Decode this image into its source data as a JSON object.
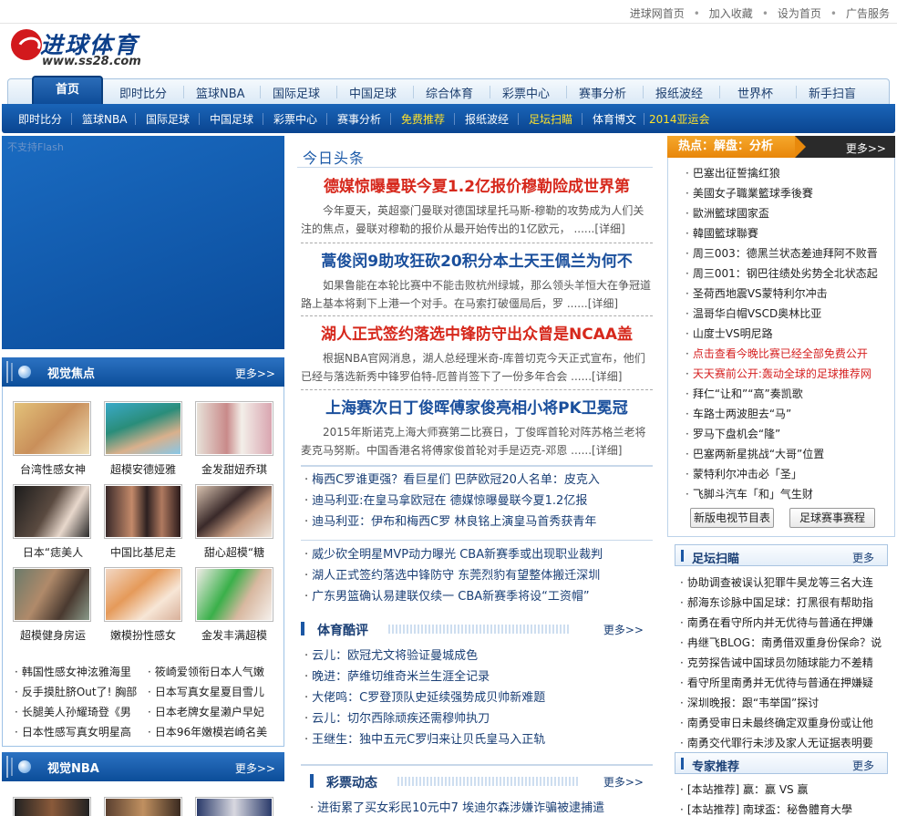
{
  "toplinks": [
    "进球网首页",
    "加入收藏",
    "设为首页",
    "广告服务"
  ],
  "logo": {
    "name": "进球体育",
    "url": "www.ss28.com"
  },
  "nav1": {
    "home": "首页",
    "items": [
      "即时比分",
      "篮球NBA",
      "国际足球",
      "中国足球",
      "综合体育",
      "彩票中心",
      "赛事分析",
      "报纸波经",
      "世界杯",
      "新手扫盲"
    ]
  },
  "nav2": {
    "items": [
      "即时比分",
      "篮球NBA",
      "国际足球",
      "中国足球",
      "彩票中心",
      "赛事分析",
      "免费推荐",
      "报纸波经",
      "足坛扫瞄",
      "体育博文",
      "2014亚运会"
    ],
    "highlight": [
      "免费推荐",
      "足坛扫瞄",
      "2014亚运会"
    ]
  },
  "flash": {
    "text": "不支持Flash"
  },
  "visual_focus": {
    "title": "视觉焦点",
    "more": "更多>>",
    "thumbs": [
      "台湾性感女神",
      "超模安德娅雅",
      "金发甜妞乔琪",
      "日本“痣美人",
      "中国比基尼走",
      "甜心超模“糖",
      "超模健身房运",
      "嫩模扮性感女",
      "金发丰满超模"
    ],
    "list_left": [
      "韩国性感女神泫雅海里",
      "反手摸肚脐Out了! 胸部",
      "长腿美人孙耀琦登《男",
      "日本性感写真女明星高"
    ],
    "list_right": [
      "筱崎爱领衔日本人气嫩",
      "日本写真女星夏目雪儿",
      "日本老牌女星濑户早妃",
      "日本96年嫩模岩崎名美"
    ]
  },
  "visual_nba": {
    "title": "视觉NBA",
    "more": "更多>>"
  },
  "headlines": {
    "title": "今日头条",
    "items": [
      {
        "h": "德媒惊曝曼联今夏1.2亿报价穆勒险成世界第",
        "p": "今年夏天，英超豪门曼联对德国球星托马斯-穆勒的攻势成为人们关注的焦点，曼联对穆勒的报价从最开始传出的1亿欧元， ......[详细]",
        "color": "red"
      },
      {
        "h": "蒿俊闵9助攻狂砍20积分本土天王佩兰为何不",
        "p": "如果鲁能在本轮比赛中不能击败杭州绿城，那么领头羊恒大在争冠道路上基本将剩下上港一个对手。在马索打破僵局后，罗 ......[详细]",
        "color": "blue"
      },
      {
        "h": "湖人正式签约落选中锋防守出众曾是NCAA盖",
        "p": "根据NBA官网消息，湖人总经理米奇-库普切克今天正式宣布，他们已经与落选新秀中锋罗伯特-厄普肖签下了一份多年合会 ......[详细]",
        "color": "red"
      },
      {
        "h": "上海赛次日丁俊晖傅家俊亮相小将PK卫冕冠",
        "p": "2015年斯诺克上海大师赛第二比赛日，丁俊晖首轮对阵苏格兰老将麦克马努斯。中国香港名将傅家俊首轮对手是迈克-邓恩 ......[详细]",
        "color": "blue"
      }
    ]
  },
  "center_list1": [
    "梅西C罗谁更强？看巨星们 巴萨欧冠20人名单：皮克入",
    "迪马利亚:在皇马拿欧冠在 德媒惊曝曼联今夏1.2亿报",
    "迪马利亚：伊布和梅西C罗 林良铭上演皇马首秀获青年"
  ],
  "center_list2": [
    "威少砍全明星MVP动力曝光 CBA新赛季或出现职业裁判",
    "湖人正式签约落选中锋防守 东莞烈豹有望整体搬迁深圳",
    "广东男篮确认易建联仅续一 CBA新赛季将设“工资帽”"
  ],
  "sports_comment": {
    "title": "体育酷评",
    "more": "更多>>",
    "items": [
      "云儿：欧冠尤文将验证曼城成色",
      "晚进：萨维切维奇米兰生涯全记录",
      "大佬鸣：C罗登顶队史延续强势成贝帅新难题",
      "云儿：切尔西除顽疾还需穆帅执刀",
      "王继生：独中五元C罗归来让贝氏皇马入正轨"
    ]
  },
  "lottery": {
    "title": "彩票动态",
    "more": "更多>>",
    "items": [
      "进街累了买女彩民10元中7 埃迪尔森涉嫌诈骗被逮捕遣"
    ]
  },
  "hot": {
    "title": "热点：解盘：分析",
    "more": "更多>>",
    "items": [
      {
        "t": "巴塞出征誓擒红狼",
        "red": false
      },
      {
        "t": "美國女子職業籃球季後賽",
        "red": false
      },
      {
        "t": "歐洲籃球國家盃",
        "red": false
      },
      {
        "t": "韓國籃球聯賽",
        "red": false
      },
      {
        "t": "周三003：德黑兰状态差迪拜阿不败晋",
        "red": false
      },
      {
        "t": "周三001：钢巴往绩处劣势全北状态起",
        "red": false
      },
      {
        "t": "圣荷西地震VS蒙特利尔冲击",
        "red": false
      },
      {
        "t": "温哥华白帽VSCD奥林比亚",
        "red": false
      },
      {
        "t": "山度士VS明尼路",
        "red": false
      },
      {
        "t": "点击查看今晚比赛已经全部免费公开",
        "red": true
      },
      {
        "t": "天天赛前公开:轰动全球的足球推荐网",
        "red": true
      },
      {
        "t": "拜仁“让和”“高”奏凯歌",
        "red": false
      },
      {
        "t": "车路士两波胆去“马”",
        "red": false
      },
      {
        "t": "罗马下盘机会“隆”",
        "red": false
      },
      {
        "t": "巴塞两新星挑战“大哥”位置",
        "red": false
      },
      {
        "t": "蒙特利尔冲击必「圣」",
        "red": false
      },
      {
        "t": "飞脚斗汽车「和」气生财",
        "red": false
      }
    ],
    "btn1": "新版电视节目表",
    "btn2": "足球赛事赛程"
  },
  "football_scan": {
    "title": "足坛扫瞄",
    "more": "更多",
    "items": [
      "协助调查被误认犯罪牛昊龙等三名大连",
      "郝海东诊脉中国足球：打黑很有帮助指",
      "南勇在看守所内并无优待与普通在押嫌",
      "冉继飞BLOG：南勇借双重身份保命？说",
      "克劳探告诫中国球员勿随球能力不差精",
      "看守所里南勇并无优待与普通在押嫌疑",
      "深圳晚报：跟“韦举国”探讨",
      "南勇受审日未最终确定双重身份或让他",
      "南勇交代罪行未涉及家人无证据表明要"
    ]
  },
  "expert": {
    "title": "专家推荐",
    "more": "更多",
    "items": [
      "[本站推荐] 赢：赢 VS 赢",
      "[本站推荐] 南球盃：秘魯體育大學"
    ]
  }
}
